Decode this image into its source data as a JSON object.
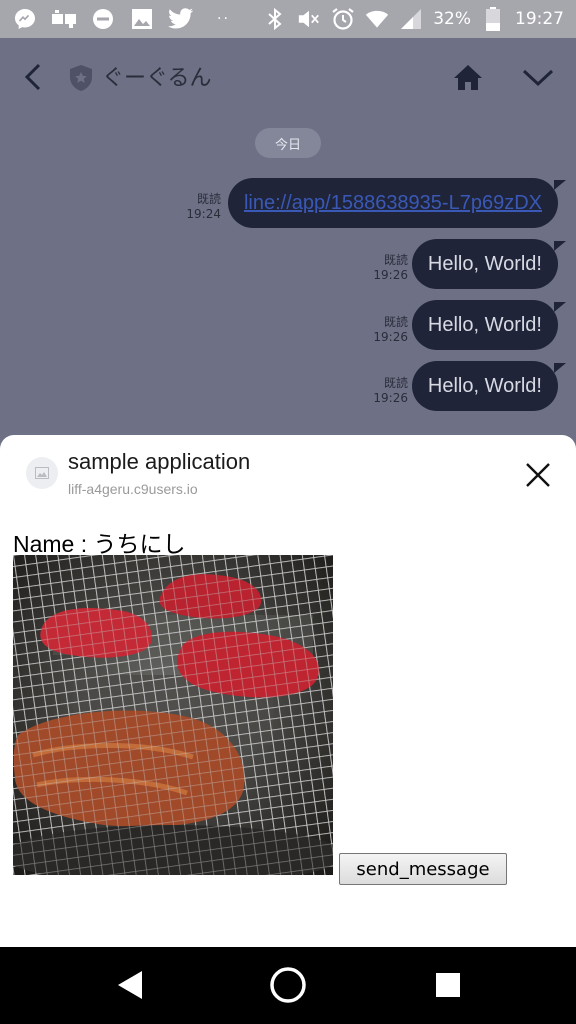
{
  "status_bar": {
    "battery": "32%",
    "time": "19:27",
    "icons": [
      "messenger-icon",
      "games-icon",
      "do-not-disturb-icon",
      "image-icon",
      "twitter-icon",
      "more-dots-icon",
      "bluetooth-icon",
      "mute-icon",
      "alarm-icon",
      "wifi-icon",
      "cell-signal-icon",
      "battery-icon"
    ]
  },
  "chat": {
    "title": "ぐーぐるん",
    "date_label": "今日",
    "messages": [
      {
        "text": "line://app/1588638935-L7p69zDX",
        "read": "既読",
        "time": "19:24",
        "is_link": true
      },
      {
        "text": "Hello, World!",
        "read": "既読",
        "time": "19:26",
        "is_link": false
      },
      {
        "text": "Hello, World!",
        "read": "既読",
        "time": "19:26",
        "is_link": false
      },
      {
        "text": "Hello, World!",
        "read": "既読",
        "time": "19:26",
        "is_link": false
      }
    ],
    "colors": {
      "background": "#6e7186",
      "bubble": "#1f2438",
      "link": "#3a59b6"
    }
  },
  "liff": {
    "app_name": "sample application",
    "app_url": "liff-a4geru.c9users.io",
    "name_text": "Name : うちにし",
    "send_button": "send_message"
  },
  "nav": {
    "icons": [
      "back-triangle-icon",
      "home-circle-icon",
      "recent-apps-square-icon"
    ]
  }
}
